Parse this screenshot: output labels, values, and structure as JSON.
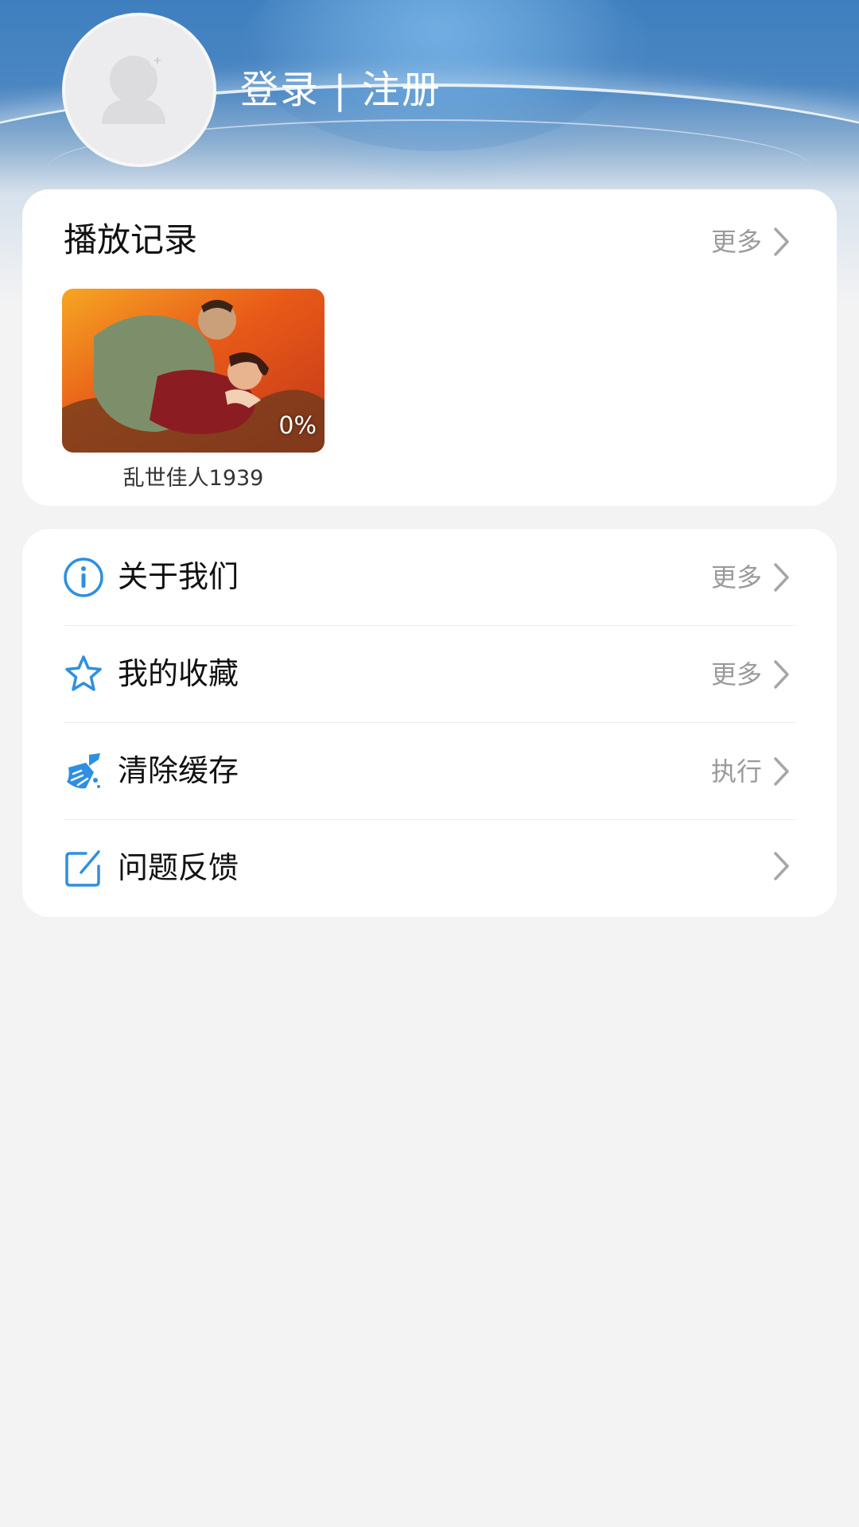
{
  "header": {
    "login_text": "登录 | 注册"
  },
  "history": {
    "title": "播放记录",
    "more_label": "更多",
    "items": [
      {
        "title": "乱世佳人1939",
        "progress": "0%"
      }
    ]
  },
  "menu": {
    "items": [
      {
        "label": "关于我们",
        "action": "更多",
        "icon": "info-icon"
      },
      {
        "label": "我的收藏",
        "action": "更多",
        "icon": "star-icon"
      },
      {
        "label": "清除缓存",
        "action": "执行",
        "icon": "broom-icon"
      },
      {
        "label": "问题反馈",
        "action": "",
        "icon": "edit-icon"
      }
    ]
  },
  "colors": {
    "accent": "#2f8fe0",
    "header_blue": "#4a86c2",
    "muted_text": "#9a9a9a",
    "background": "#f3f3f4"
  }
}
